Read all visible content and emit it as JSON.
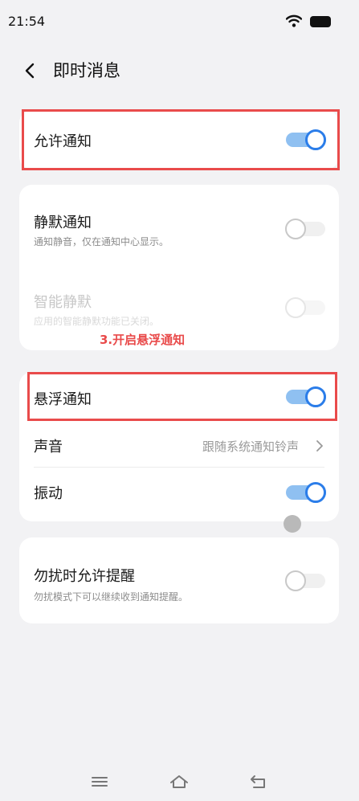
{
  "status": {
    "time": "21:54"
  },
  "nav": {
    "title": "即时消息"
  },
  "allow_notification": {
    "label": "允许通知",
    "enabled": true
  },
  "silent_card": {
    "silent": {
      "label": "静默通知",
      "sub": "通知静音，仅在通知中心显示。",
      "enabled": false
    },
    "smart_silent": {
      "label": "智能静默",
      "sub": "应用的智能静默功能已关闭。",
      "enabled": false
    }
  },
  "annotation": {
    "text": "3.开启悬浮通知"
  },
  "float_card": {
    "floating": {
      "label": "悬浮通知",
      "enabled": true
    },
    "sound": {
      "label": "声音",
      "value": "跟随系统通知铃声"
    },
    "vibrate": {
      "label": "振动",
      "enabled": true
    }
  },
  "dnd_card": {
    "dnd": {
      "label": "勿扰时允许提醒",
      "sub": "勿扰模式下可以继续收到通知提醒。",
      "enabled": false
    }
  },
  "colors": {
    "accent": "#2b7de9",
    "highlight": "#e94b4b"
  },
  "icons": [
    "wifi-icon",
    "battery-icon",
    "back-icon",
    "chevron-right-icon",
    "menu-icon",
    "home-icon",
    "return-icon"
  ]
}
